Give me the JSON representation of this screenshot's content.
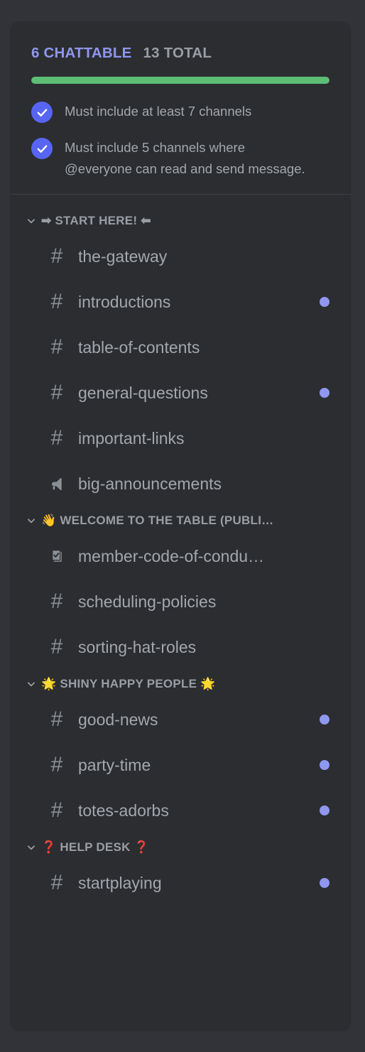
{
  "summary": {
    "chattable_label": "6 CHATTABLE",
    "total_label": "13 TOTAL",
    "progress_percent": 100,
    "colors": {
      "chattable": "#8f97ee",
      "total": "#9a9ea4",
      "progress": "#5dbd74",
      "check": "#5865f2",
      "dot": "#8f97ee",
      "card_bg": "#2b2d31",
      "page_bg": "#313338"
    },
    "requirements": [
      {
        "checked": true,
        "text": "Must include at least 7 channels"
      },
      {
        "checked": true,
        "text": "Must include 5 channels where @everyone can read and send message."
      }
    ]
  },
  "channel_list": {
    "categories": [
      {
        "emoji_prefix": "➡",
        "label": "START HERE!",
        "emoji_suffix": "⬅",
        "expanded": true,
        "channels": [
          {
            "icon": "hash-icon",
            "name": "the-gateway",
            "dot": false
          },
          {
            "icon": "hash-icon",
            "name": "introductions",
            "dot": true
          },
          {
            "icon": "hash-icon",
            "name": "table-of-contents",
            "dot": false
          },
          {
            "icon": "hash-icon",
            "name": "general-questions",
            "dot": true
          },
          {
            "icon": "hash-icon",
            "name": "important-links",
            "dot": false
          },
          {
            "icon": "announcement-icon",
            "name": "big-announcements",
            "dot": false
          }
        ]
      },
      {
        "emoji_prefix": "👋",
        "label": "WELCOME TO THE TABLE (PUBLI…",
        "emoji_suffix": "",
        "expanded": true,
        "channels": [
          {
            "icon": "rules-icon",
            "name": "member-code-of-condu…",
            "dot": false
          },
          {
            "icon": "hash-icon",
            "name": "scheduling-policies",
            "dot": false
          },
          {
            "icon": "hash-icon",
            "name": "sorting-hat-roles",
            "dot": false
          }
        ]
      },
      {
        "emoji_prefix": "🌟",
        "label": "SHINY HAPPY PEOPLE",
        "emoji_suffix": "🌟",
        "expanded": true,
        "channels": [
          {
            "icon": "hash-icon",
            "name": "good-news",
            "dot": true
          },
          {
            "icon": "hash-icon",
            "name": "party-time",
            "dot": true
          },
          {
            "icon": "hash-icon",
            "name": "totes-adorbs",
            "dot": true
          }
        ]
      },
      {
        "emoji_prefix": "❓",
        "label": "HELP DESK",
        "emoji_suffix": "❓",
        "expanded": true,
        "channels": [
          {
            "icon": "hash-icon",
            "name": "startplaying",
            "dot": true
          }
        ]
      }
    ]
  }
}
